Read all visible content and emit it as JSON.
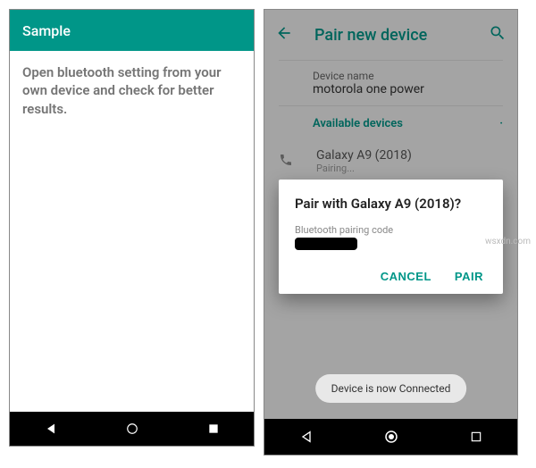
{
  "left": {
    "app_title": "Sample",
    "body_text": "Open bluetooth setting from your own device and check for better results."
  },
  "right": {
    "header_title": "Pair new device",
    "device_name_label": "Device name",
    "device_name_value": "motorola one power",
    "available_label": "Available devices",
    "found_device_name": "Galaxy A9 (2018)",
    "found_device_status": "Pairing...",
    "dialog": {
      "title": "Pair with Galaxy A9 (2018)?",
      "code_label": "Bluetooth pairing code",
      "cancel": "CANCEL",
      "pair": "PAIR"
    },
    "toast": "Device is now Connected"
  },
  "watermark": "wsxdn.com"
}
